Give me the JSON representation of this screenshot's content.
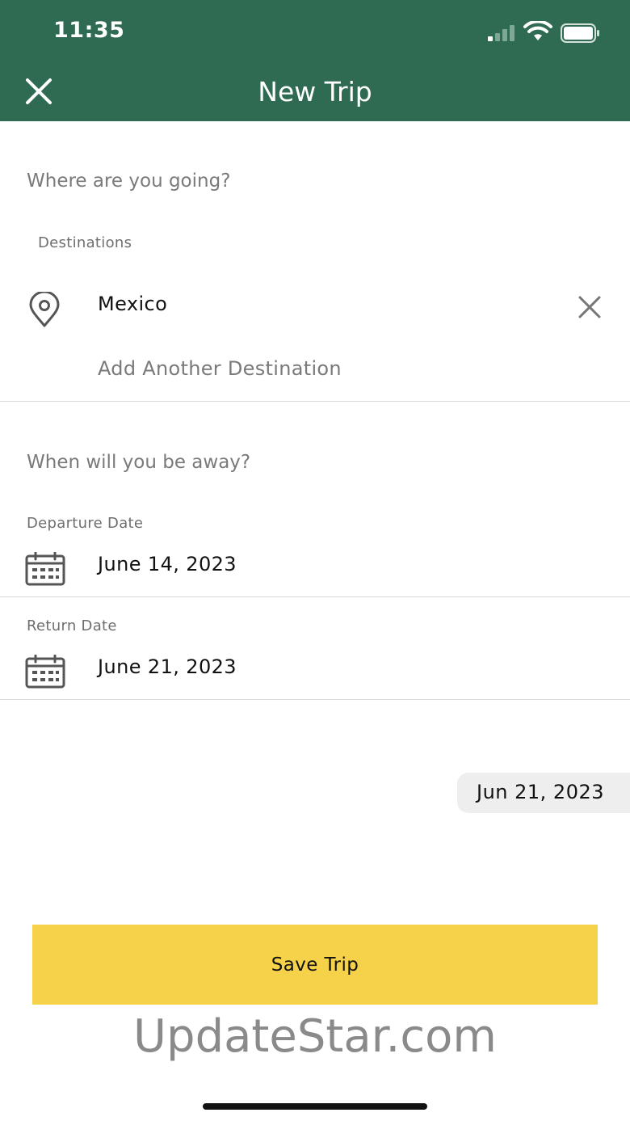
{
  "status_bar": {
    "time": "11:35"
  },
  "header": {
    "title": "New Trip",
    "close_icon": "close-icon"
  },
  "destinations_section": {
    "question": "Where are you going?",
    "label": "Destinations",
    "items": [
      {
        "name": "Mexico",
        "icon": "location-pin-icon",
        "remove_icon": "close-icon"
      }
    ],
    "add_placeholder": "Add Another Destination"
  },
  "dates_section": {
    "question": "When will you be away?",
    "departure": {
      "label": "Departure Date",
      "value": "June 14, 2023",
      "icon": "calendar-icon"
    },
    "return": {
      "label": "Return Date",
      "value": "June 21, 2023",
      "icon": "calendar-icon"
    }
  },
  "date_chip": {
    "value": "Jun 21, 2023"
  },
  "save_button": {
    "label": "Save Trip"
  },
  "watermark": {
    "text": "UpdateStar.com"
  },
  "colors": {
    "header": "#2f6b53",
    "save_button": "#f5d24a"
  }
}
